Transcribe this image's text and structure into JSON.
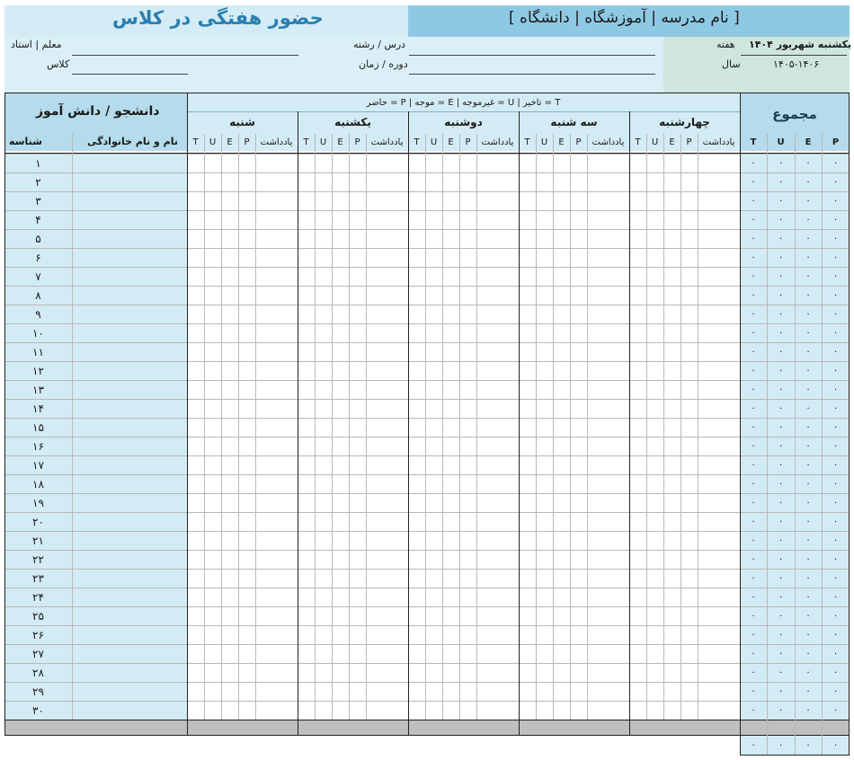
{
  "header": {
    "school_name": "[ نام مدرسه | آموزشگاه | دانشگاه ]",
    "title": "حضور هفتگی در کلاس"
  },
  "info": {
    "week_label": "هفته",
    "week_value": "یکشنبه شهریور ۱۴۰۴",
    "year_label": "سال",
    "year_value": "۱۴۰۵-۱۴۰۶",
    "course_label": "درس / رشته",
    "period_label": "دوره / زمان",
    "teacher_label": "معلم | استاد",
    "class_label": "کلاس"
  },
  "legend": "حاضر = P   |   موجه = E   |   غیرموجه = U   |   تاخیر = T",
  "students_header": "دانشجو / دانش آموز",
  "col_id": "شناسه",
  "col_name": "نام و نام خانوادگی",
  "total_header": "مجموع",
  "note_label": "یادداشت",
  "codes": [
    "P",
    "E",
    "U",
    "T"
  ],
  "days": [
    "شنبه",
    "یکشنبه",
    "دوشنبه",
    "سه شنبه",
    "چهارشنبه"
  ],
  "row_ids": [
    "۱",
    "۲",
    "۳",
    "۴",
    "۵",
    "۶",
    "۷",
    "۸",
    "۹",
    "۱۰",
    "۱۱",
    "۱۲",
    "۱۳",
    "۱۴",
    "۱۵",
    "۱۶",
    "۱۷",
    "۱۸",
    "۱۹",
    "۲۰",
    "۲۱",
    "۲۲",
    "۲۳",
    "۲۴",
    "۲۵",
    "۲۶",
    "۲۷",
    "۲۸",
    "۲۹",
    "۳۰"
  ],
  "zero": "۰",
  "colors": {
    "school_bg": "#8ec9e3",
    "title_text": "#2a7fb0",
    "accent_blue": "#b4dcec",
    "light_blue": "#d3ebf4",
    "green": "#cfe6dc",
    "footer_gray": "#bfbfbf"
  }
}
